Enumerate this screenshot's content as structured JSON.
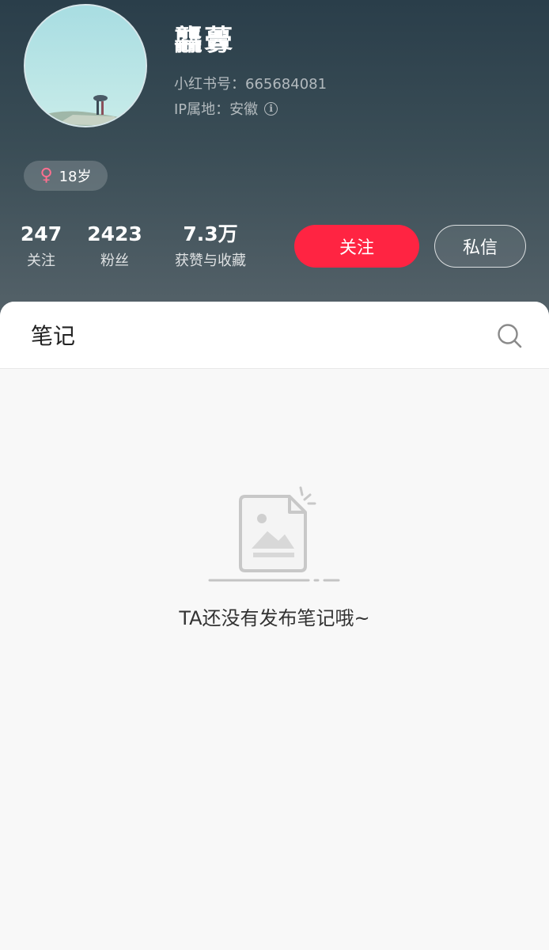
{
  "profile": {
    "nickname": "龘虋",
    "id_line": "小红书号：665684081",
    "ip_line": "IP属地：安徽",
    "gender_symbol": "♀",
    "age": "18岁"
  },
  "stats": [
    {
      "value": "247",
      "label": "关注"
    },
    {
      "value": "2423",
      "label": "粉丝"
    },
    {
      "value": "7.3万",
      "label": "获赞与收藏"
    }
  ],
  "actions": {
    "follow_label": "关注",
    "message_label": "私信"
  },
  "tabs": {
    "notes_label": "笔记"
  },
  "empty_state": {
    "text": "TA还没有发布笔记哦~"
  },
  "colors": {
    "accent": "#ff2442",
    "gender": "#ff6f8f"
  },
  "icons": {
    "info": "info-icon",
    "search": "search-icon",
    "empty": "empty-document-icon"
  }
}
